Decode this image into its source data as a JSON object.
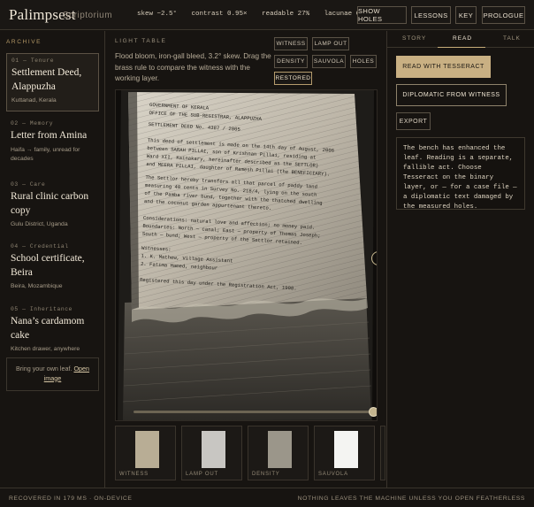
{
  "app": {
    "brand": "Palimpsest",
    "subtitle": "Scriptorium",
    "stats": [
      "skew −2.5°",
      "contrast 0.95×",
      "readable 27%",
      "lacunae 6"
    ],
    "buttons": [
      "SHOW HOLES",
      "LESSONS",
      "KEY",
      "PROLOGUE"
    ]
  },
  "archive": {
    "label": "ARCHIVE",
    "items": [
      {
        "kicker": "01 — Tenure",
        "title": "Settlement Deed, Alappuzha",
        "meta": "Kuttanad, Kerala"
      },
      {
        "kicker": "02 — Memory",
        "title": "Letter from Amina",
        "meta": "Haifa → family, unread for decades"
      },
      {
        "kicker": "03 — Care",
        "title": "Rural clinic carbon copy",
        "meta": "Gulu District, Uganda"
      },
      {
        "kicker": "04 — Credential",
        "title": "School certificate, Beira",
        "meta": "Beira, Mozambique"
      },
      {
        "kicker": "05 — Inheritance",
        "title": "Nana’s cardamom cake",
        "meta": "Kitchen drawer, anywhere"
      }
    ],
    "byo_text": "Bring your own leaf.",
    "byo_link": "Open image"
  },
  "lighttable": {
    "label": "LIGHT TABLE",
    "description": "Flood bloom, iron-gall bleed, 3.2° skew. Drag the brass rule to compare the witness with the working layer.",
    "chips": [
      "WITNESS",
      "LAMP OUT",
      "DENSITY",
      "SAUVOLA",
      "HOLES",
      "RESTORED"
    ],
    "active_chip": "RESTORED",
    "doc_lines": [
      "GOVERNMENT OF KERALA",
      "OFFICE OF THE SUB-REGISTRAR, ALAPPUZHA",
      "SETTLEMENT DEED No. 4387 / 2005",
      "This deed of settlement is made on the 14th day of August, 2006",
      "between SARAH PILLAI, son of Krishnan Pillai, residing at",
      "Ward XII, Kainakary, hereinafter described as the SETTLOR)",
      "and MEERA PILLAI, daughter of Ramesh Pillai (the BENEFICIARY).",
      "The Settlor hereby transfers all that parcel of paddy land",
      "measuring 40 cents in Survey No. 218/4, lying on the south",
      "of the Pamba river bund, together with the thatched dwelling",
      "and the coconut garden appurtenant thereto.",
      "Considerations: natural love and affection; no money paid.",
      "Boundaries: North — canal; East — property of Thomas Joseph;",
      "South — bund; West — property of the Settlor retained.",
      "Witnesses:",
      "1. K. Mathew, Village Assistant",
      "2. Fatima Hamed, neighbour",
      "Registered this day under the Registration Act, 1908."
    ],
    "slider_value": 0.98,
    "thumbs": [
      "WITNESS",
      "LAMP OUT",
      "DENSITY",
      "SAUVOLA",
      "H"
    ]
  },
  "panel": {
    "tabs": [
      "STORY",
      "READ",
      "TALK"
    ],
    "active_tab": "READ",
    "primary": "READ WITH TESSERACT",
    "secondary": "DIPLOMATIC FROM WITNESS",
    "export": "EXPORT",
    "note": "The bench has enhanced the leaf. Reading is a separate, fallible act. Choose Tesseract on the binary layer, or — for a case file — a diplomatic text damaged by the measured holes."
  },
  "footer": {
    "left": "RECOVERED IN 179 MS · ON-DEVICE",
    "right": "NOTHING LEAVES THE MACHINE UNLESS YOU OPEN FEATHERLESS"
  },
  "colors": {
    "accent": "#c7ad78",
    "bg": "#171411"
  }
}
